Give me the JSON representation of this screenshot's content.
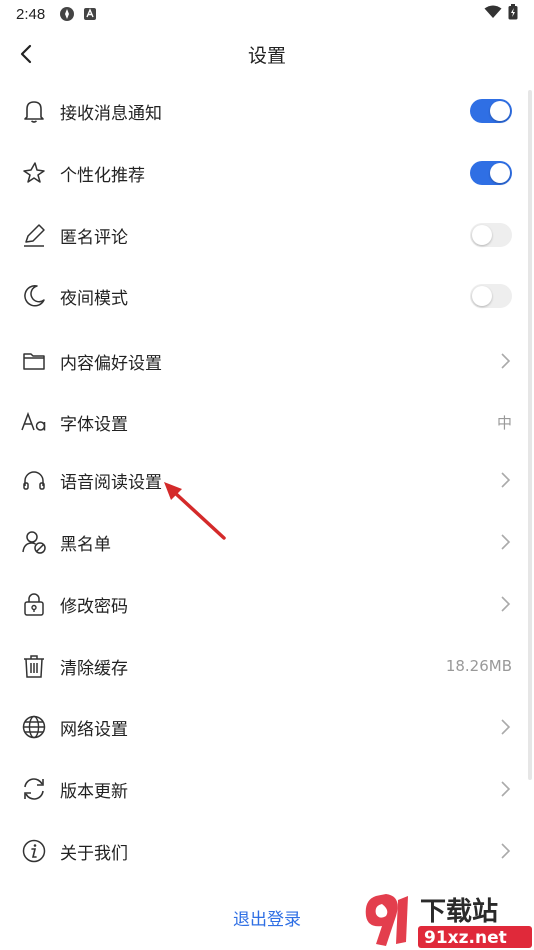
{
  "status_bar": {
    "time": "2:48"
  },
  "header": {
    "title": "设置"
  },
  "items": [
    {
      "label": "接收消息通知",
      "type": "toggle",
      "on": true,
      "icon": "bell-icon"
    },
    {
      "label": "个性化推荐",
      "type": "toggle",
      "on": true,
      "icon": "sparkle-icon"
    },
    {
      "label": "匿名评论",
      "type": "toggle",
      "on": false,
      "icon": "pencil-icon"
    },
    {
      "label": "夜间模式",
      "type": "toggle",
      "on": false,
      "icon": "moon-icon"
    },
    {
      "label": "内容偏好设置",
      "type": "chevron",
      "icon": "folder-icon"
    },
    {
      "label": "字体设置",
      "type": "value",
      "value": "中",
      "icon": "font-icon"
    },
    {
      "label": "语音阅读设置",
      "type": "chevron",
      "icon": "headphones-icon"
    },
    {
      "label": "黑名单",
      "type": "chevron",
      "icon": "blocked-user-icon"
    },
    {
      "label": "修改密码",
      "type": "chevron",
      "icon": "lock-icon"
    },
    {
      "label": "清除缓存",
      "type": "value",
      "value": "18.26MB",
      "icon": "trash-icon"
    },
    {
      "label": "网络设置",
      "type": "chevron",
      "icon": "globe-icon"
    },
    {
      "label": "版本更新",
      "type": "chevron",
      "icon": "refresh-icon"
    },
    {
      "label": "关于我们",
      "type": "chevron",
      "icon": "info-icon"
    }
  ],
  "logout_label": "退出登录",
  "toggle_on_color": "#2f6fe4",
  "watermark": {
    "brand": "下载站",
    "domain": "91xz.net"
  }
}
